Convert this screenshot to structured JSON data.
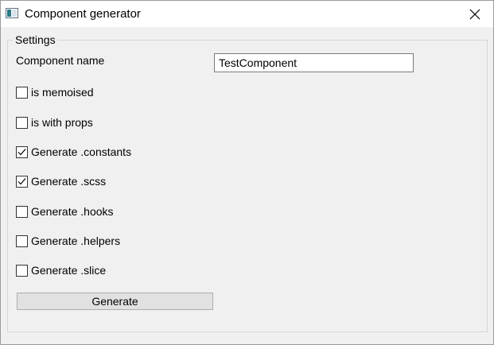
{
  "window": {
    "title": "Component generator",
    "app_icon": "app-window-icon",
    "close_icon": "close-icon"
  },
  "settings": {
    "group_title": "Settings",
    "component_name_label": "Component name",
    "component_name_value": "TestComponent",
    "options": [
      {
        "label": "is memoised",
        "checked": false
      },
      {
        "label": "is with props",
        "checked": false
      },
      {
        "label": "Generate .constants",
        "checked": true
      },
      {
        "label": "Generate .scss",
        "checked": true
      },
      {
        "label": "Generate .hooks",
        "checked": false
      },
      {
        "label": "Generate .helpers",
        "checked": false
      },
      {
        "label": "Generate .slice",
        "checked": false
      }
    ],
    "generate_button_label": "Generate"
  }
}
